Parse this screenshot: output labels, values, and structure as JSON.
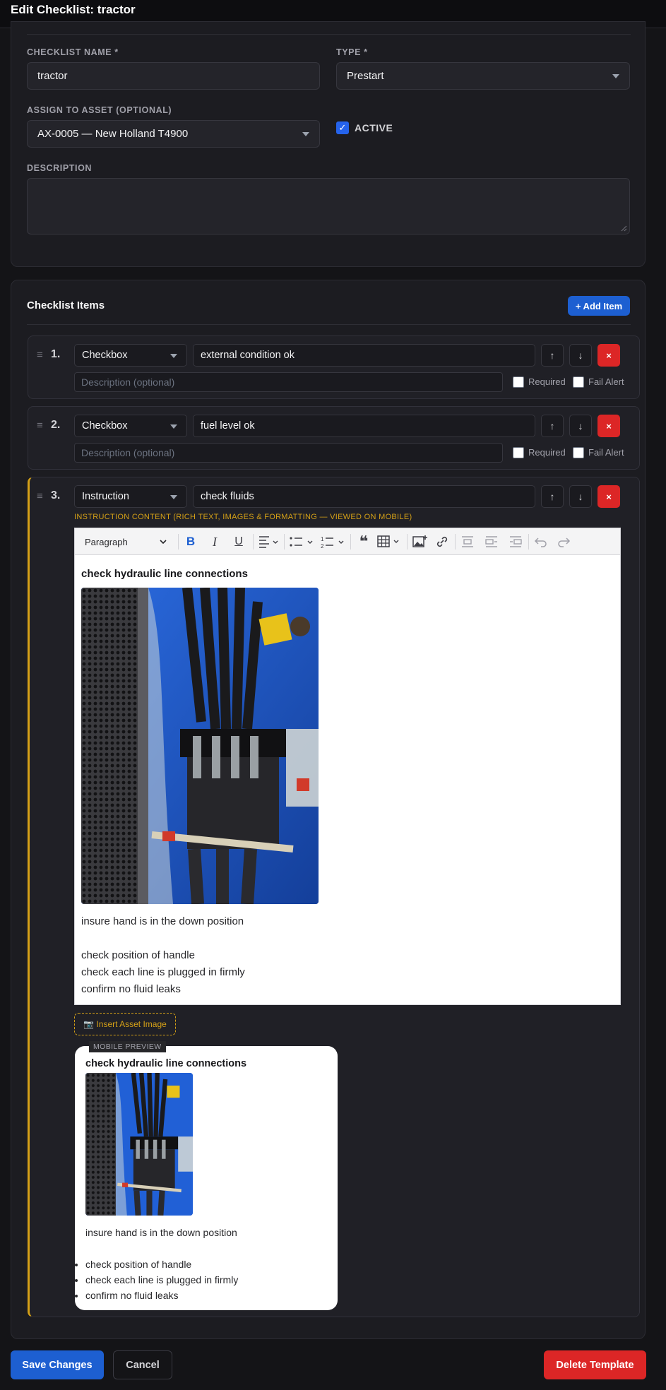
{
  "header": {
    "title": "Edit Checklist: tractor"
  },
  "form": {
    "name_label": "CHECKLIST NAME *",
    "name_value": "tractor",
    "type_label": "TYPE *",
    "type_value": "Prestart",
    "asset_label": "ASSIGN TO ASSET (OPTIONAL)",
    "asset_value": "AX-0005 — New Holland T4900",
    "active_label": "ACTIVE",
    "active_checked": true,
    "description_label": "DESCRIPTION",
    "description_value": ""
  },
  "items_section": {
    "title": "Checklist Items",
    "add_button": "+ Add Item",
    "items": [
      {
        "number": "1.",
        "type": "Checkbox",
        "label": "external condition ok",
        "description_placeholder": "Description (optional)",
        "required_label": "Required",
        "fail_alert_label": "Fail Alert"
      },
      {
        "number": "2.",
        "type": "Checkbox",
        "label": "fuel level ok",
        "description_placeholder": "Description (optional)",
        "required_label": "Required",
        "fail_alert_label": "Fail Alert"
      },
      {
        "number": "3.",
        "type": "Instruction",
        "label": "check fluids"
      }
    ],
    "up_arrow": "↑",
    "down_arrow": "↓",
    "delete_glyph": "×"
  },
  "instruction": {
    "content_label": "INSTRUCTION CONTENT (RICH TEXT, IMAGES & FORMATTING — VIEWED ON MOBILE)",
    "toolbar": {
      "block_style": "Paragraph"
    },
    "editor": {
      "heading": "check hydraulic line connections",
      "line1": "insure hand is in the down position",
      "line2": "check position of handle",
      "line3": "check each line is plugged in firmly",
      "line4": "confirm no fluid leaks"
    },
    "insert_asset_button": "📷 Insert Asset Image",
    "preview_badge": "MOBILE PREVIEW",
    "preview": {
      "heading": "check hydraulic line connections",
      "line1": "insure hand is in the down position",
      "bullets": [
        "check position of handle",
        "check each line is plugged in firmly",
        "confirm no fluid leaks"
      ]
    }
  },
  "footer": {
    "save": "Save Changes",
    "cancel": "Cancel",
    "delete": "Delete Template"
  },
  "colors": {
    "accent_blue": "#2563eb",
    "danger_red": "#dc2626",
    "instruction_highlight": "#d4a017"
  }
}
